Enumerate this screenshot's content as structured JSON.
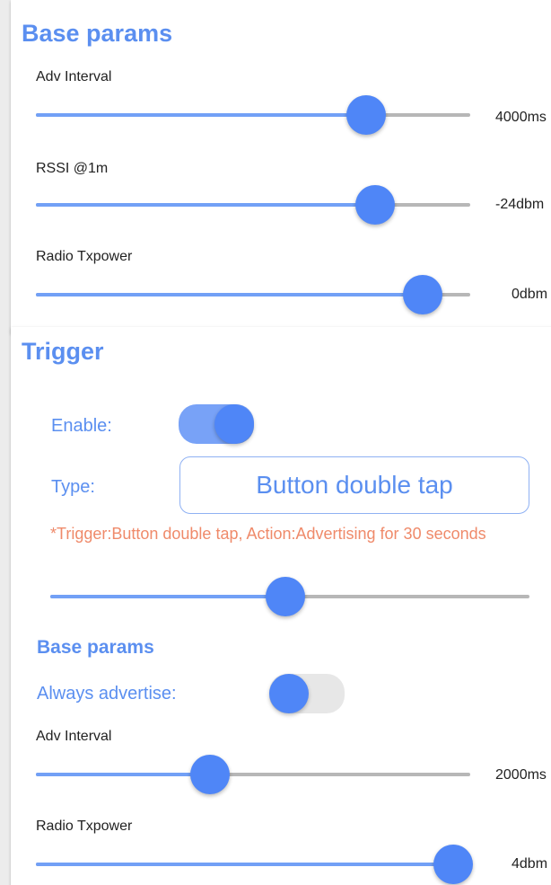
{
  "colors": {
    "accent": "#5b8ff0",
    "thumb": "#4f86f7",
    "track_active": "#72a0f6",
    "track_inactive": "#b7b7b7",
    "note": "#ef8a6a"
  },
  "base_params": {
    "title": "Base params",
    "sliders": [
      {
        "label": "Adv Interval",
        "value_text": "4000ms",
        "fraction": 0.76
      },
      {
        "label": "RSSI @1m",
        "value_text": "-24dbm",
        "fraction": 0.78
      },
      {
        "label": "Radio Txpower",
        "value_text": "0dbm",
        "fraction": 0.89
      }
    ]
  },
  "trigger": {
    "title": "Trigger",
    "enable_label": "Enable:",
    "enable_on": true,
    "type_label": "Type:",
    "type_value": "Button double tap",
    "note": "*Trigger:Button double tap, Action:Advertising for 30 seconds",
    "trigger_slider_fraction": 0.49,
    "base_params": {
      "title": "Base params",
      "always_advertise_label": "Always advertise:",
      "always_advertise_on": false,
      "sliders": [
        {
          "label": "Adv Interval",
          "value_text": "2000ms",
          "fraction": 0.4
        },
        {
          "label": "Radio Txpower",
          "value_text": "4dbm",
          "fraction": 0.96
        }
      ]
    }
  }
}
